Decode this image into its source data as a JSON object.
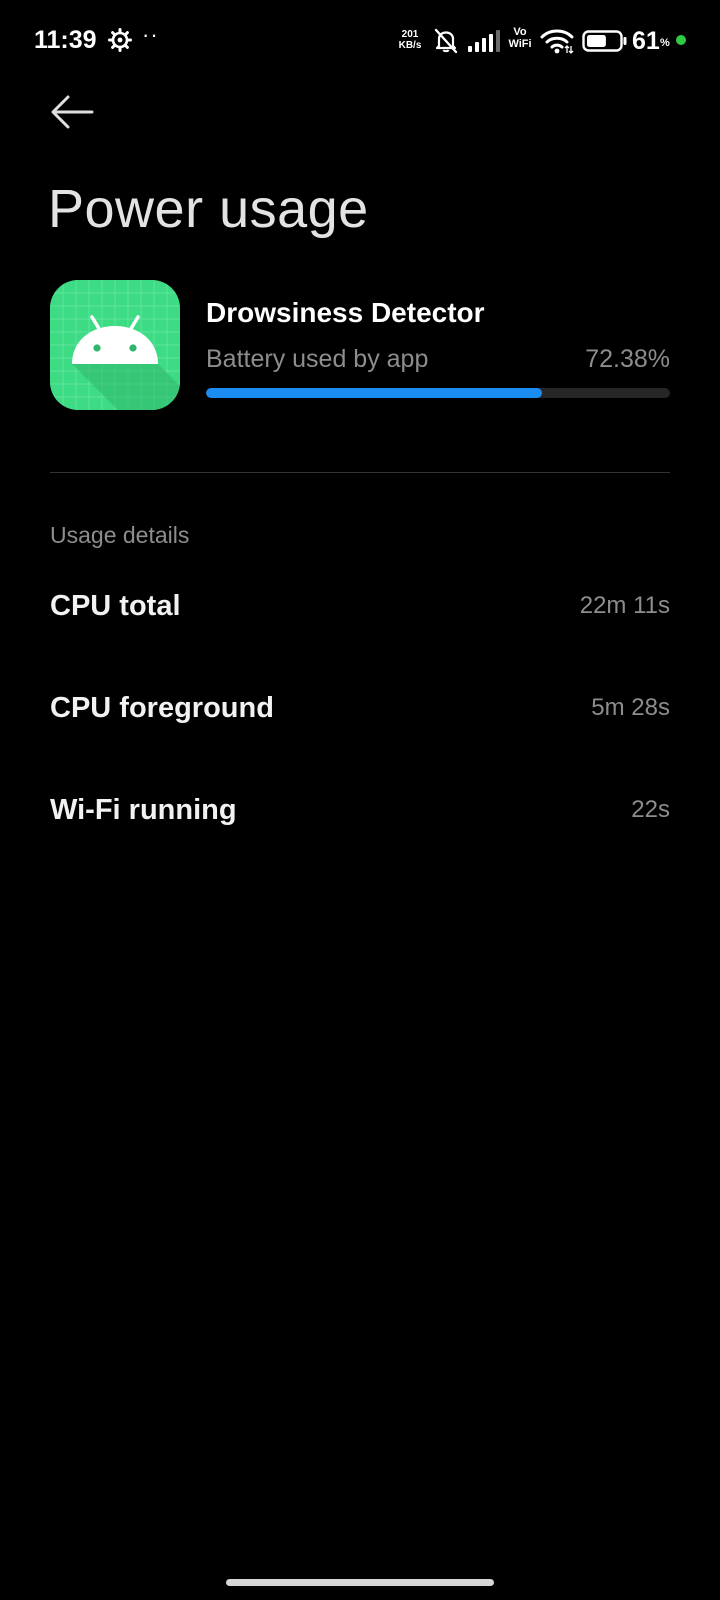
{
  "status_bar": {
    "time": "11:39",
    "dots": "··",
    "net_speed_value": "201",
    "net_speed_unit": "KB/s",
    "vo_label": "Vo",
    "wifi_label": "WiFi",
    "battery_level": "61",
    "battery_percent_sign": "%",
    "battery_fill_fraction": 0.61,
    "indicator_color": "#2ecc40",
    "icons": [
      "gear-icon",
      "mute-icon",
      "signal-icon",
      "wifi-icon",
      "battery-icon"
    ]
  },
  "header": {
    "back_icon": "back-arrow-icon",
    "title": "Power usage"
  },
  "app": {
    "name": "Drowsiness Detector",
    "icon": "android-icon",
    "icon_color": "#3ddc84",
    "battery_label": "Battery used by app",
    "battery_percent": "72.38%",
    "battery_fraction": 0.7238,
    "bar_color": "#1a8cf2"
  },
  "usage_details": {
    "section_title": "Usage details",
    "rows": [
      {
        "label": "CPU total",
        "value": "22m 11s"
      },
      {
        "label": "CPU foreground",
        "value": "5m 28s"
      },
      {
        "label": "Wi-Fi running",
        "value": "22s"
      }
    ]
  }
}
